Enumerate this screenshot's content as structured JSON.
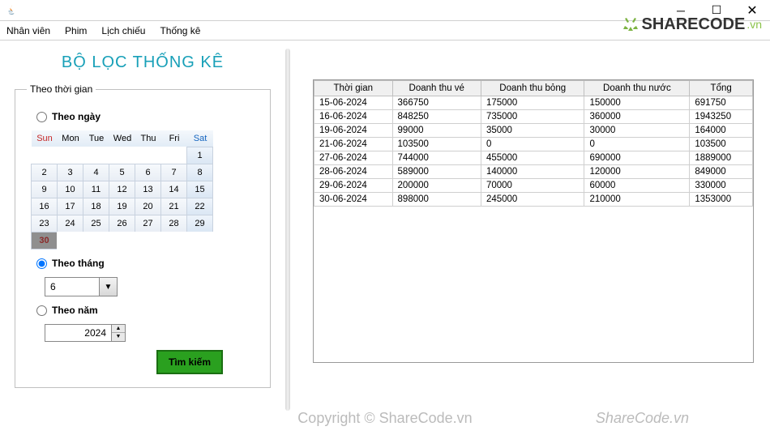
{
  "menubar": {
    "items": [
      "Nhân viên",
      "Phim",
      "Lịch chiếu",
      "Thống kê"
    ]
  },
  "watermark": {
    "brand": "SHARECODE",
    "tld": ".vn",
    "copyright": "Copyright © ShareCode.vn",
    "site": "ShareCode.vn"
  },
  "filter": {
    "title": "BỘ LỌC THỐNG KÊ",
    "group_legend": "Theo thời gian",
    "by_day": "Theo ngày",
    "by_month": "Theo tháng",
    "by_year": "Theo năm",
    "month_value": "6",
    "year_value": "2024",
    "search_label": "Tìm kiếm",
    "selected_mode": "month",
    "calendar": {
      "headers": [
        "Sun",
        "Mon",
        "Tue",
        "Wed",
        "Thu",
        "Fri",
        "Sat"
      ],
      "weeks": [
        [
          "",
          "",
          "",
          "",
          "",
          "",
          "1"
        ],
        [
          "2",
          "3",
          "4",
          "5",
          "6",
          "7",
          "8"
        ],
        [
          "9",
          "10",
          "11",
          "12",
          "13",
          "14",
          "15"
        ],
        [
          "16",
          "17",
          "18",
          "19",
          "20",
          "21",
          "22"
        ],
        [
          "23",
          "24",
          "25",
          "26",
          "27",
          "28",
          "29"
        ],
        [
          "30",
          "",
          "",
          "",
          "",
          "",
          ""
        ]
      ],
      "today": "30"
    }
  },
  "table": {
    "columns": [
      "Thời gian",
      "Doanh thu vé",
      "Doanh thu bỏng",
      "Doanh thu nước",
      "Tổng"
    ],
    "rows": [
      [
        "15-06-2024",
        "366750",
        "175000",
        "150000",
        "691750"
      ],
      [
        "16-06-2024",
        "848250",
        "735000",
        "360000",
        "1943250"
      ],
      [
        "19-06-2024",
        "99000",
        "35000",
        "30000",
        "164000"
      ],
      [
        "21-06-2024",
        "103500",
        "0",
        "0",
        "103500"
      ],
      [
        "27-06-2024",
        "744000",
        "455000",
        "690000",
        "1889000"
      ],
      [
        "28-06-2024",
        "589000",
        "140000",
        "120000",
        "849000"
      ],
      [
        "29-06-2024",
        "200000",
        "70000",
        "60000",
        "330000"
      ],
      [
        "30-06-2024",
        "898000",
        "245000",
        "210000",
        "1353000"
      ]
    ]
  }
}
